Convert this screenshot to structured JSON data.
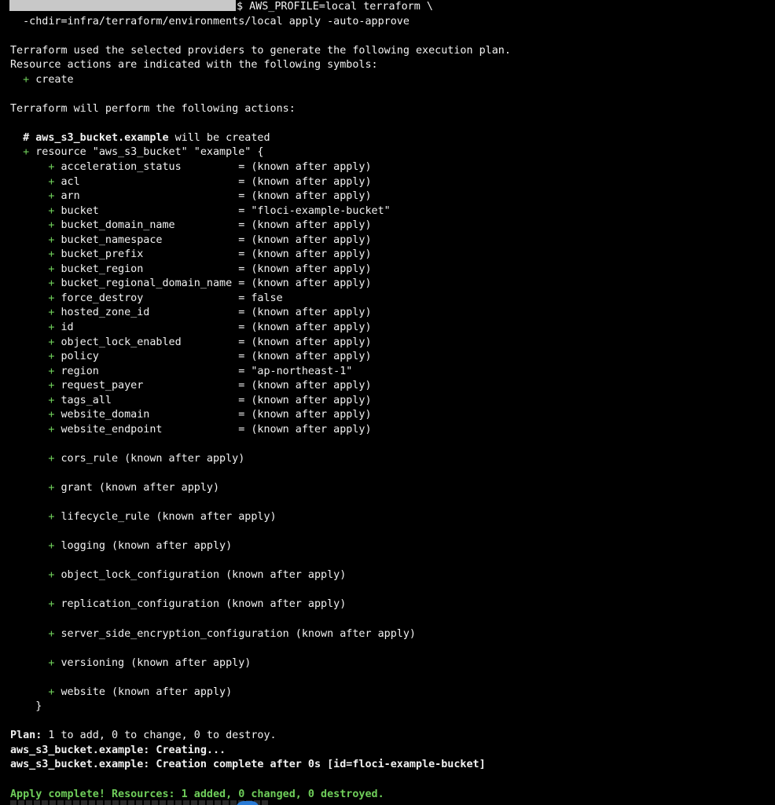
{
  "command": {
    "prompt_symbol": "$",
    "line1": " AWS_PROFILE=local terraform \\",
    "line2": "  -chdir=infra/terraform/environments/local apply -auto-approve"
  },
  "intro": {
    "line1": "Terraform used the selected providers to generate the following execution plan.",
    "line2": "Resource actions are indicated with the following symbols:",
    "symbol_plus": "+",
    "symbol_label": "create",
    "actions_heading": "Terraform will perform the following actions:"
  },
  "resource": {
    "comment_hash": "#",
    "address": "aws_s3_bucket.example",
    "will_be_created": " will be created",
    "header": " resource \"aws_s3_bucket\" \"example\" {",
    "closing_brace": "    }",
    "attributes": [
      {
        "name": "acceleration_status        ",
        "value": "= (known after apply)"
      },
      {
        "name": "acl                        ",
        "value": "= (known after apply)"
      },
      {
        "name": "arn                        ",
        "value": "= (known after apply)"
      },
      {
        "name": "bucket                     ",
        "value": "= \"floci-example-bucket\""
      },
      {
        "name": "bucket_domain_name         ",
        "value": "= (known after apply)"
      },
      {
        "name": "bucket_namespace           ",
        "value": "= (known after apply)"
      },
      {
        "name": "bucket_prefix              ",
        "value": "= (known after apply)"
      },
      {
        "name": "bucket_region              ",
        "value": "= (known after apply)"
      },
      {
        "name": "bucket_regional_domain_name",
        "value": "= (known after apply)"
      },
      {
        "name": "force_destroy              ",
        "value": "= false"
      },
      {
        "name": "hosted_zone_id             ",
        "value": "= (known after apply)"
      },
      {
        "name": "id                         ",
        "value": "= (known after apply)"
      },
      {
        "name": "object_lock_enabled        ",
        "value": "= (known after apply)"
      },
      {
        "name": "policy                     ",
        "value": "= (known after apply)"
      },
      {
        "name": "region                     ",
        "value": "= \"ap-northeast-1\""
      },
      {
        "name": "request_payer              ",
        "value": "= (known after apply)"
      },
      {
        "name": "tags_all                   ",
        "value": "= (known after apply)"
      },
      {
        "name": "website_domain             ",
        "value": "= (known after apply)"
      },
      {
        "name": "website_endpoint           ",
        "value": "= (known after apply)"
      }
    ],
    "blocks": [
      "cors_rule (known after apply)",
      "grant (known after apply)",
      "lifecycle_rule (known after apply)",
      "logging (known after apply)",
      "object_lock_configuration (known after apply)",
      "replication_configuration (known after apply)",
      "server_side_encryption_configuration (known after apply)",
      "versioning (known after apply)",
      "website (known after apply)"
    ]
  },
  "summary": {
    "plan_label": "Plan:",
    "plan_text": " 1 to add, 0 to change, 0 to destroy.",
    "creating": "aws_s3_bucket.example: Creating...",
    "complete": "aws_s3_bucket.example: Creation complete after 0s [id=floci-example-bucket]",
    "apply_complete": "Apply complete! Resources: 1 added, 0 changed, 0 destroyed."
  },
  "colors": {
    "background": "#000000",
    "foreground": "#f2f2f2",
    "plus_green": "#6fce5a",
    "redaction": "#c8c8c8"
  }
}
